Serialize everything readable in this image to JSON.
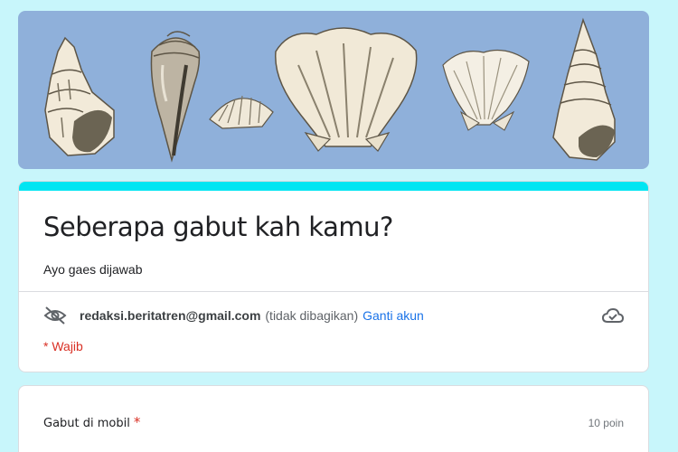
{
  "colors": {
    "accent": "#00e5f2",
    "background": "#c8f6fb",
    "banner": "#8fb0da",
    "link": "#1a73e8",
    "required": "#d93025"
  },
  "form": {
    "title": "Seberapa gabut kah kamu?",
    "description": "Ayo gaes dijawab"
  },
  "account": {
    "email": "redaksi.beritatren@gmail.com",
    "visibility_note": "(tidak dibagikan)",
    "switch_label": "Ganti akun",
    "hidden_icon": "eye-off-icon",
    "cloud_icon": "cloud-check-icon"
  },
  "required_note": "* Wajib",
  "question": {
    "title": "Gabut di mobil",
    "required_mark": "*",
    "points": "10 poin"
  }
}
